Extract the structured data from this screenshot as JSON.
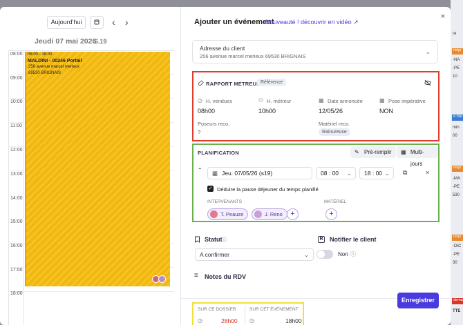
{
  "calendar": {
    "today_label": "Aujourd'hui",
    "prev_arrow": "‹",
    "next_arrow": "›",
    "day_title": "Jeudi 07 mai 2026",
    "week": "S.19",
    "hours": [
      "08:00",
      "09:00",
      "10:00",
      "11:00",
      "12:00",
      "13:00",
      "14:00",
      "15:00",
      "16:00",
      "17:00",
      "18:00"
    ],
    "event": {
      "time": "08:00 - 18:00",
      "name": "MALDINI - 00246 Portail",
      "addr1": "256 avenue marcel merieux",
      "addr2": "69530 BRIGNAIS"
    }
  },
  "modal": {
    "title": "Ajouter un événement",
    "news_link": "Nouveauté ! découvrir en vidéo ↗",
    "close": "×",
    "address": {
      "label": "Adresse du client",
      "value": "256 avenue marcel merieux 69530 BRIGNAIS"
    },
    "rapport": {
      "title": "RAPPORT METREUR",
      "tag": "Référence",
      "fields": [
        {
          "label": "H. vendues",
          "value": "08h00"
        },
        {
          "label": "H. métreur",
          "value": "10h00"
        },
        {
          "label": "Date annoncée",
          "value": "12/05/26"
        },
        {
          "label": "Pose impérative",
          "value": "NON"
        }
      ],
      "poseurs_label": "Poseurs reco.",
      "poseurs_value": "?",
      "materiel_label": "Matériel reco.",
      "materiel_tag": "Rainureuse"
    },
    "planification": {
      "title": "PLANIFICATION",
      "prefill": "Pré-remplir",
      "multi": "Multi-jours",
      "date": "Jeu. 07/05/26 (s19)",
      "start_h": "08",
      "start_m": "00",
      "end_h": "18",
      "end_m": "00",
      "pause_label": "Déduire la pause déjeuner du temps planifié",
      "intervenants_label": "INTERVENANTS",
      "intervenants": [
        "T. Peauze",
        "J. Reno"
      ],
      "materiel_label": "MATÉRIEL"
    },
    "statut": {
      "label": "Statut",
      "value": "A confirmer"
    },
    "notify": {
      "label": "Notifier le client",
      "value": "Non"
    },
    "notes_label": "Notes du RDV",
    "totals": [
      {
        "label": "SUR CE DOSSIER",
        "value": "28h00",
        "color": "#d9342b"
      },
      {
        "label": "SUR CET ÉVÉNEMENT",
        "value": "18h00",
        "color": "#333333"
      }
    ],
    "save": "Enregistrer"
  },
  "background": {
    "chips": [
      "requ",
      "e clie",
      "requ",
      "requ",
      "dema"
    ],
    "texts": [
      "re",
      "-NA",
      "-PE",
      "10",
      "min",
      "00",
      "-MA",
      "-PE",
      "530",
      "-DIC",
      "-PE",
      "30",
      "TTE"
    ]
  },
  "colors": {
    "accent": "#4a3be0",
    "event": "#f2b80e",
    "rapport_border": "#e23b2e",
    "plan_border": "#6ab04c",
    "totals_border": "#f2df3a"
  }
}
